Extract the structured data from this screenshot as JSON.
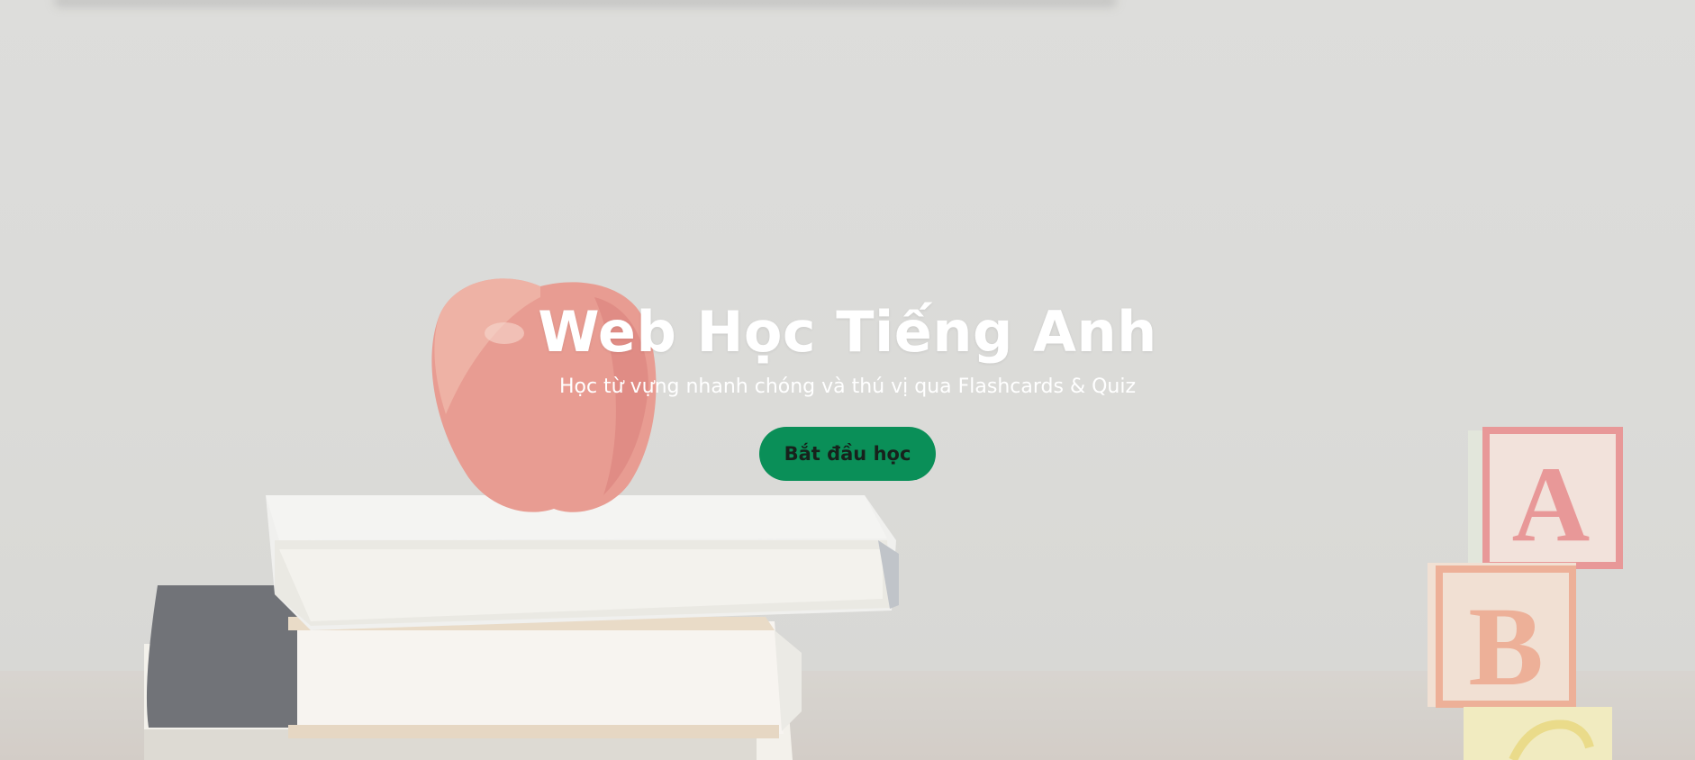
{
  "hero": {
    "title": "Web Học Tiếng Anh",
    "subtitle": "Học từ vựng nhanh chóng và thú vị qua Flashcards & Quiz",
    "cta_label": "Bắt đầu học"
  },
  "background": {
    "block_letters": [
      "A",
      "B"
    ],
    "colors": {
      "accent": "#0a8f58",
      "text": "#ffffff"
    }
  }
}
